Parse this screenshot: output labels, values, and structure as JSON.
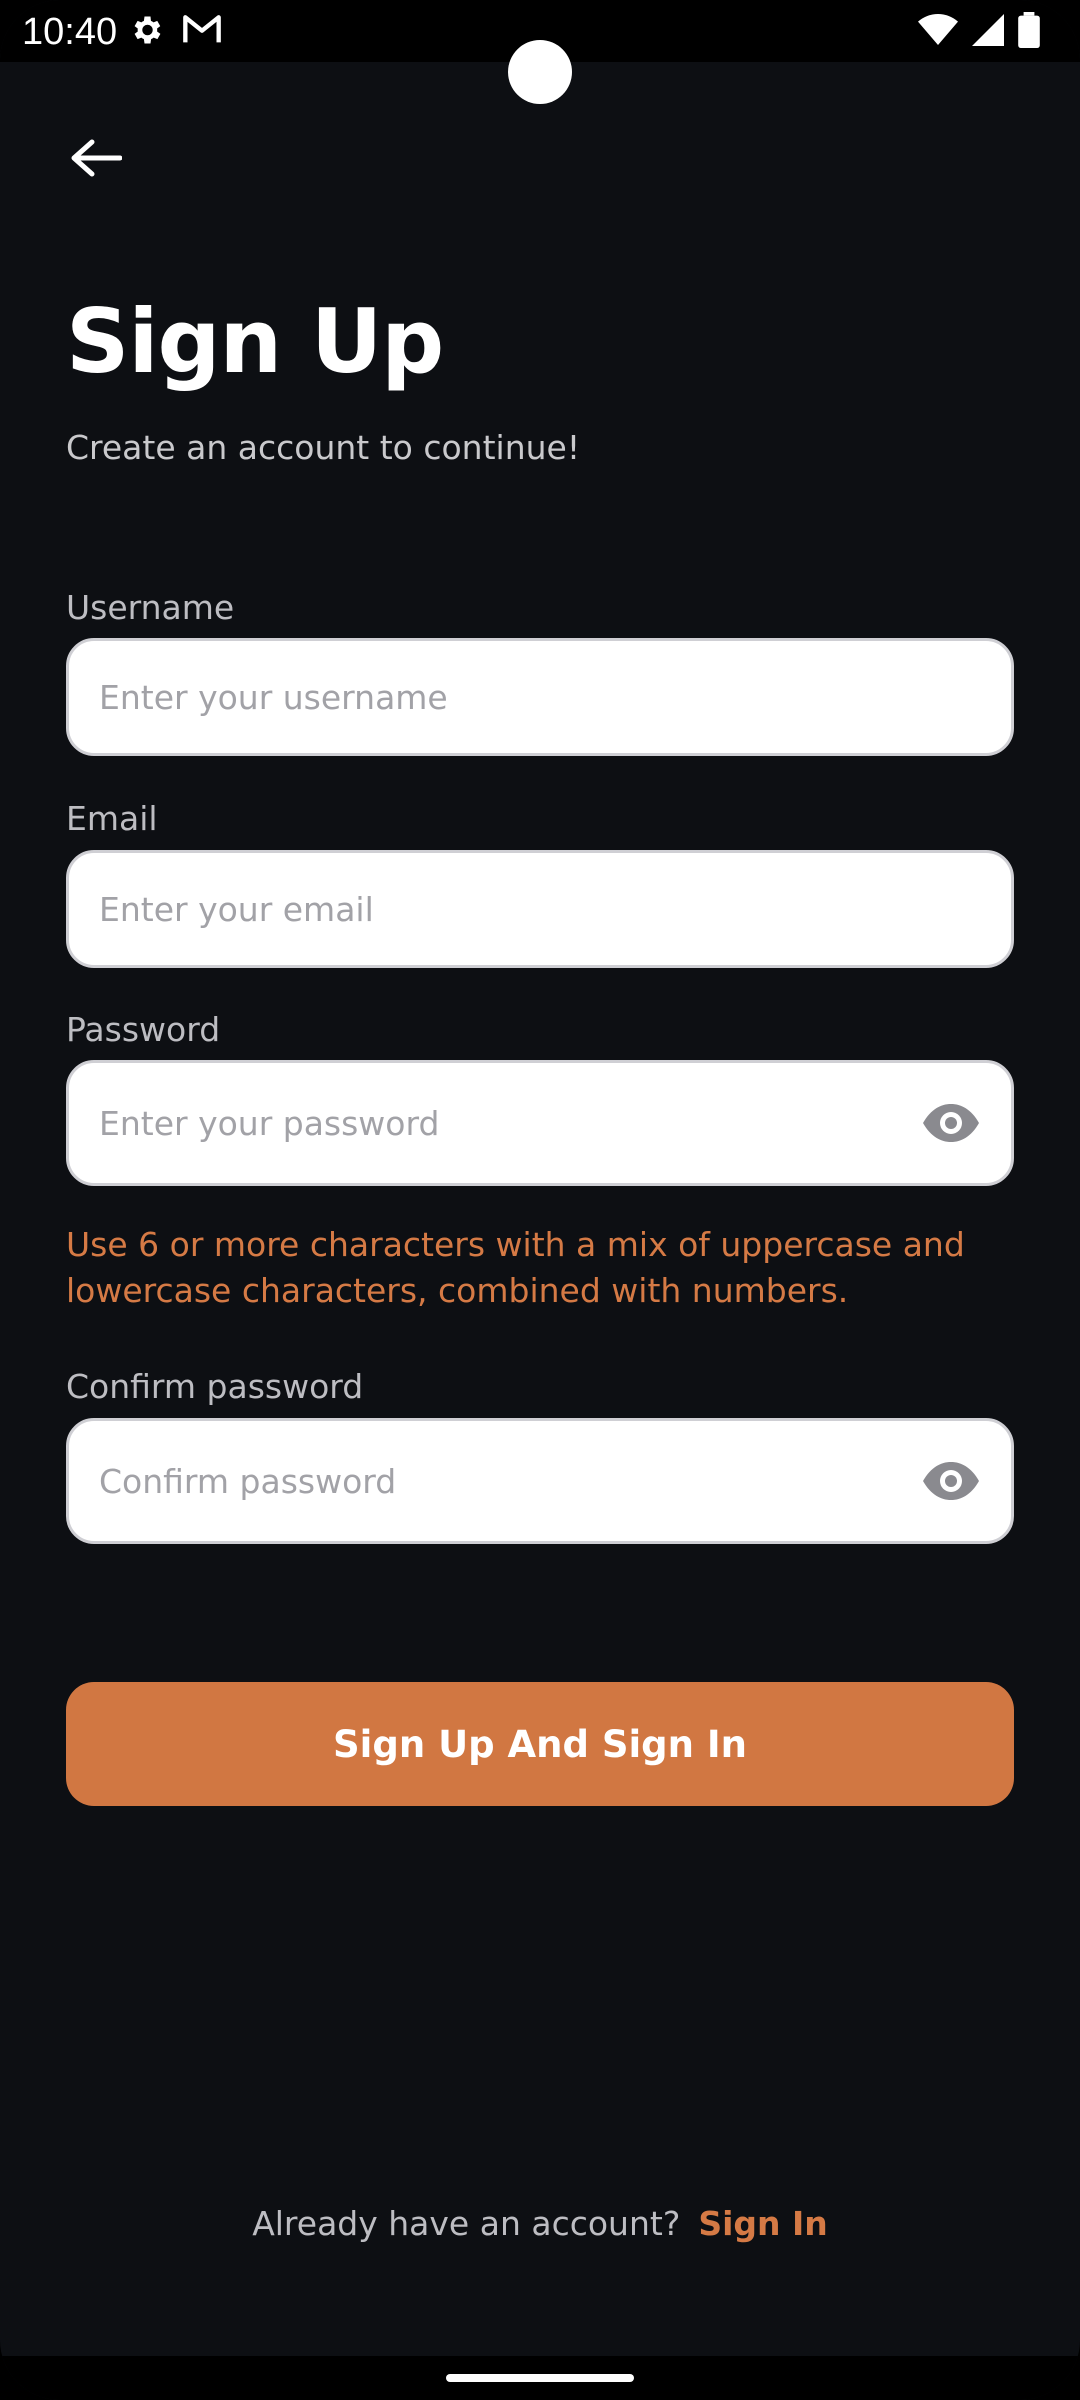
{
  "status_bar": {
    "time": "10:40",
    "left_icons": [
      "gear-icon",
      "gmail-icon"
    ],
    "right_icons": [
      "wifi-icon",
      "cell-signal-icon",
      "battery-icon"
    ]
  },
  "header": {
    "back_icon": "arrow-left-icon"
  },
  "page": {
    "title": "Sign Up",
    "subtitle": "Create an account to continue!"
  },
  "form": {
    "username": {
      "label": "Username",
      "placeholder": "Enter your username",
      "value": ""
    },
    "email": {
      "label": "Email",
      "placeholder": "Enter your email",
      "value": ""
    },
    "password": {
      "label": "Password",
      "placeholder": "Enter your password",
      "value": "",
      "toggle_icon": "eye-icon"
    },
    "password_hint": "Use 6 or more characters with a mix of uppercase and lowercase characters, combined with numbers.",
    "confirm_password": {
      "label": "Confirm password",
      "placeholder": "Confirm password",
      "value": "",
      "toggle_icon": "eye-icon"
    },
    "submit_label": "Sign Up And Sign In"
  },
  "footer": {
    "prompt": "Already have an account?",
    "link_label": "Sign In"
  },
  "colors": {
    "background": "#0d0f13",
    "accent": "#d17742",
    "input_background": "#ffffff",
    "placeholder": "#a2a2a7"
  }
}
